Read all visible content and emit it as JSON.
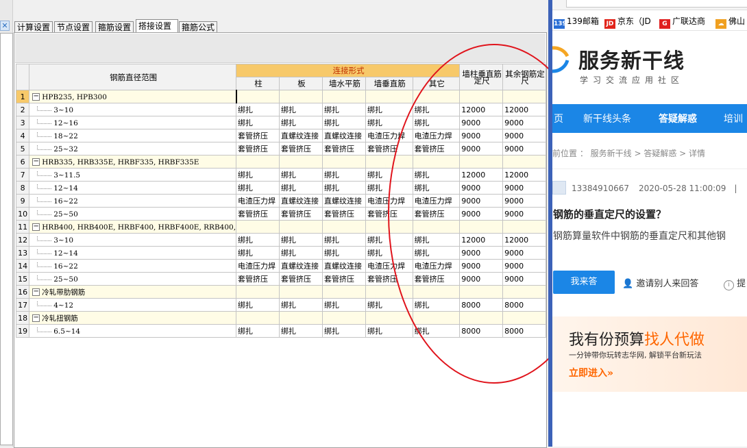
{
  "tabs": [
    "计算设置",
    "节点设置",
    "箍筋设置",
    "搭接设置",
    "箍筋公式"
  ],
  "active_tab": "搭接设置",
  "grid": {
    "col_range": "钢筋直径范围",
    "group_header": "连接形式",
    "sub_headers": [
      "柱",
      "板",
      "墙水平筋",
      "墙垂直筋",
      "其它"
    ],
    "col_col_length": "墙柱垂直筋定尺",
    "col_other_length": "其余钢筋定尺",
    "rows": [
      {
        "n": "1",
        "group": true,
        "range": "HPB235, HPB300"
      },
      {
        "n": "2",
        "range": "3~10",
        "cells": [
          "绑扎",
          "绑扎",
          "绑扎",
          "绑扎",
          "绑扎",
          "12000",
          "12000"
        ]
      },
      {
        "n": "3",
        "range": "12~16",
        "cells": [
          "绑扎",
          "绑扎",
          "绑扎",
          "绑扎",
          "绑扎",
          "9000",
          "9000"
        ]
      },
      {
        "n": "4",
        "range": "18~22",
        "cells": [
          "套管挤压",
          "直螺纹连接",
          "直螺纹连接",
          "电渣压力焊",
          "电渣压力焊",
          "9000",
          "9000"
        ]
      },
      {
        "n": "5",
        "range": "25~32",
        "cells": [
          "套管挤压",
          "套管挤压",
          "套管挤压",
          "套管挤压",
          "套管挤压",
          "9000",
          "9000"
        ]
      },
      {
        "n": "6",
        "group": true,
        "range": "HRB335, HRB335E, HRBF335, HRBF335E"
      },
      {
        "n": "7",
        "range": "3~11.5",
        "cells": [
          "绑扎",
          "绑扎",
          "绑扎",
          "绑扎",
          "绑扎",
          "12000",
          "12000"
        ]
      },
      {
        "n": "8",
        "range": "12~14",
        "cells": [
          "绑扎",
          "绑扎",
          "绑扎",
          "绑扎",
          "绑扎",
          "9000",
          "9000"
        ]
      },
      {
        "n": "9",
        "range": "16~22",
        "cells": [
          "电渣压力焊",
          "直螺纹连接",
          "直螺纹连接",
          "电渣压力焊",
          "电渣压力焊",
          "9000",
          "9000"
        ]
      },
      {
        "n": "10",
        "range": "25~50",
        "cells": [
          "套管挤压",
          "套管挤压",
          "套管挤压",
          "套管挤压",
          "套管挤压",
          "9000",
          "9000"
        ]
      },
      {
        "n": "11",
        "group": true,
        "range": "HRB400, HRB400E, HRBF400, HRBF400E, RRB400,"
      },
      {
        "n": "12",
        "range": "3~10",
        "cells": [
          "绑扎",
          "绑扎",
          "绑扎",
          "绑扎",
          "绑扎",
          "12000",
          "12000"
        ]
      },
      {
        "n": "13",
        "range": "12~14",
        "cells": [
          "绑扎",
          "绑扎",
          "绑扎",
          "绑扎",
          "绑扎",
          "9000",
          "9000"
        ]
      },
      {
        "n": "14",
        "range": "16~22",
        "cells": [
          "电渣压力焊",
          "直螺纹连接",
          "直螺纹连接",
          "电渣压力焊",
          "电渣压力焊",
          "9000",
          "9000"
        ]
      },
      {
        "n": "15",
        "range": "25~50",
        "cells": [
          "套管挤压",
          "套管挤压",
          "套管挤压",
          "套管挤压",
          "套管挤压",
          "9000",
          "9000"
        ]
      },
      {
        "n": "16",
        "group": true,
        "range": "冷轧带肋钢筋"
      },
      {
        "n": "17",
        "range": "4~12",
        "cells": [
          "绑扎",
          "绑扎",
          "绑扎",
          "绑扎",
          "绑扎",
          "8000",
          "8000"
        ]
      },
      {
        "n": "18",
        "group": true,
        "range": "冷轧扭钢筋"
      },
      {
        "n": "19",
        "range": "6.5~14",
        "cells": [
          "绑扎",
          "绑扎",
          "绑扎",
          "绑扎",
          "绑扎",
          "8000",
          "8000"
        ]
      }
    ]
  },
  "annotation_color": "#e0141c",
  "browser": {
    "bookmarks": [
      {
        "icon": "139",
        "label": "139邮箱",
        "color": "#2a6fd6"
      },
      {
        "icon": "JD",
        "label": "京东（JD",
        "color": "#e1251b"
      },
      {
        "icon": "G",
        "label": "广联达商",
        "color": "#e02020"
      },
      {
        "icon": "☁",
        "label": "佛山",
        "color": "#f0a020"
      }
    ],
    "logo_title": "服务新干线",
    "logo_sub": "学习交流应用社区",
    "nav": [
      "页",
      "新干线头条",
      "答疑解惑",
      "培训"
    ],
    "nav_active": "答疑解惑",
    "breadcrumb": "前位置 ： 服务新干线 > 答疑解惑 > 详情",
    "author": "13384910667",
    "date": "2020-05-28 11:00:09",
    "question_title": "钢筋的垂直定尺的设置？",
    "question_body": "钢筋算量软件中钢筋的垂直定尺和其他钢",
    "answer_button": "我来答",
    "invite": "邀请别人来回答",
    "report": "提",
    "banner_title_a": "我有份预算",
    "banner_title_b": "找人代做",
    "banner_sub": "一分钟带你玩转志华网, 解锁平台新玩法",
    "banner_cta": "立即进入»",
    "brand_blue": "#1b86e6",
    "brand_orange": "#ff6600"
  }
}
